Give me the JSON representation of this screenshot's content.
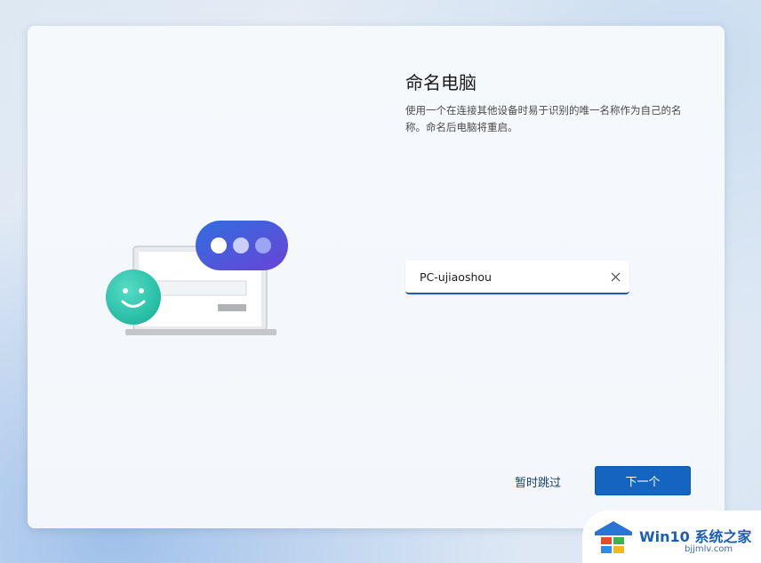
{
  "page": {
    "title": "命名电脑",
    "description": "使用一个在连接其他设备时易于识别的唯一名称作为自己的名称。命名后电脑将重启。"
  },
  "name_field": {
    "value": "PC-ujiaoshou",
    "clear_icon": "close-icon"
  },
  "actions": {
    "skip_label": "暂时跳过",
    "next_label": "下一个"
  },
  "watermark": {
    "brand_a": "Win10",
    "brand_b": "系统之家",
    "url": "bjjmlv.com"
  },
  "colors": {
    "accent": "#1565c0",
    "link": "#17406e",
    "bubble_start": "#2f6fe0",
    "bubble_end": "#6a43d6",
    "smiley": "#2fc7b0"
  }
}
